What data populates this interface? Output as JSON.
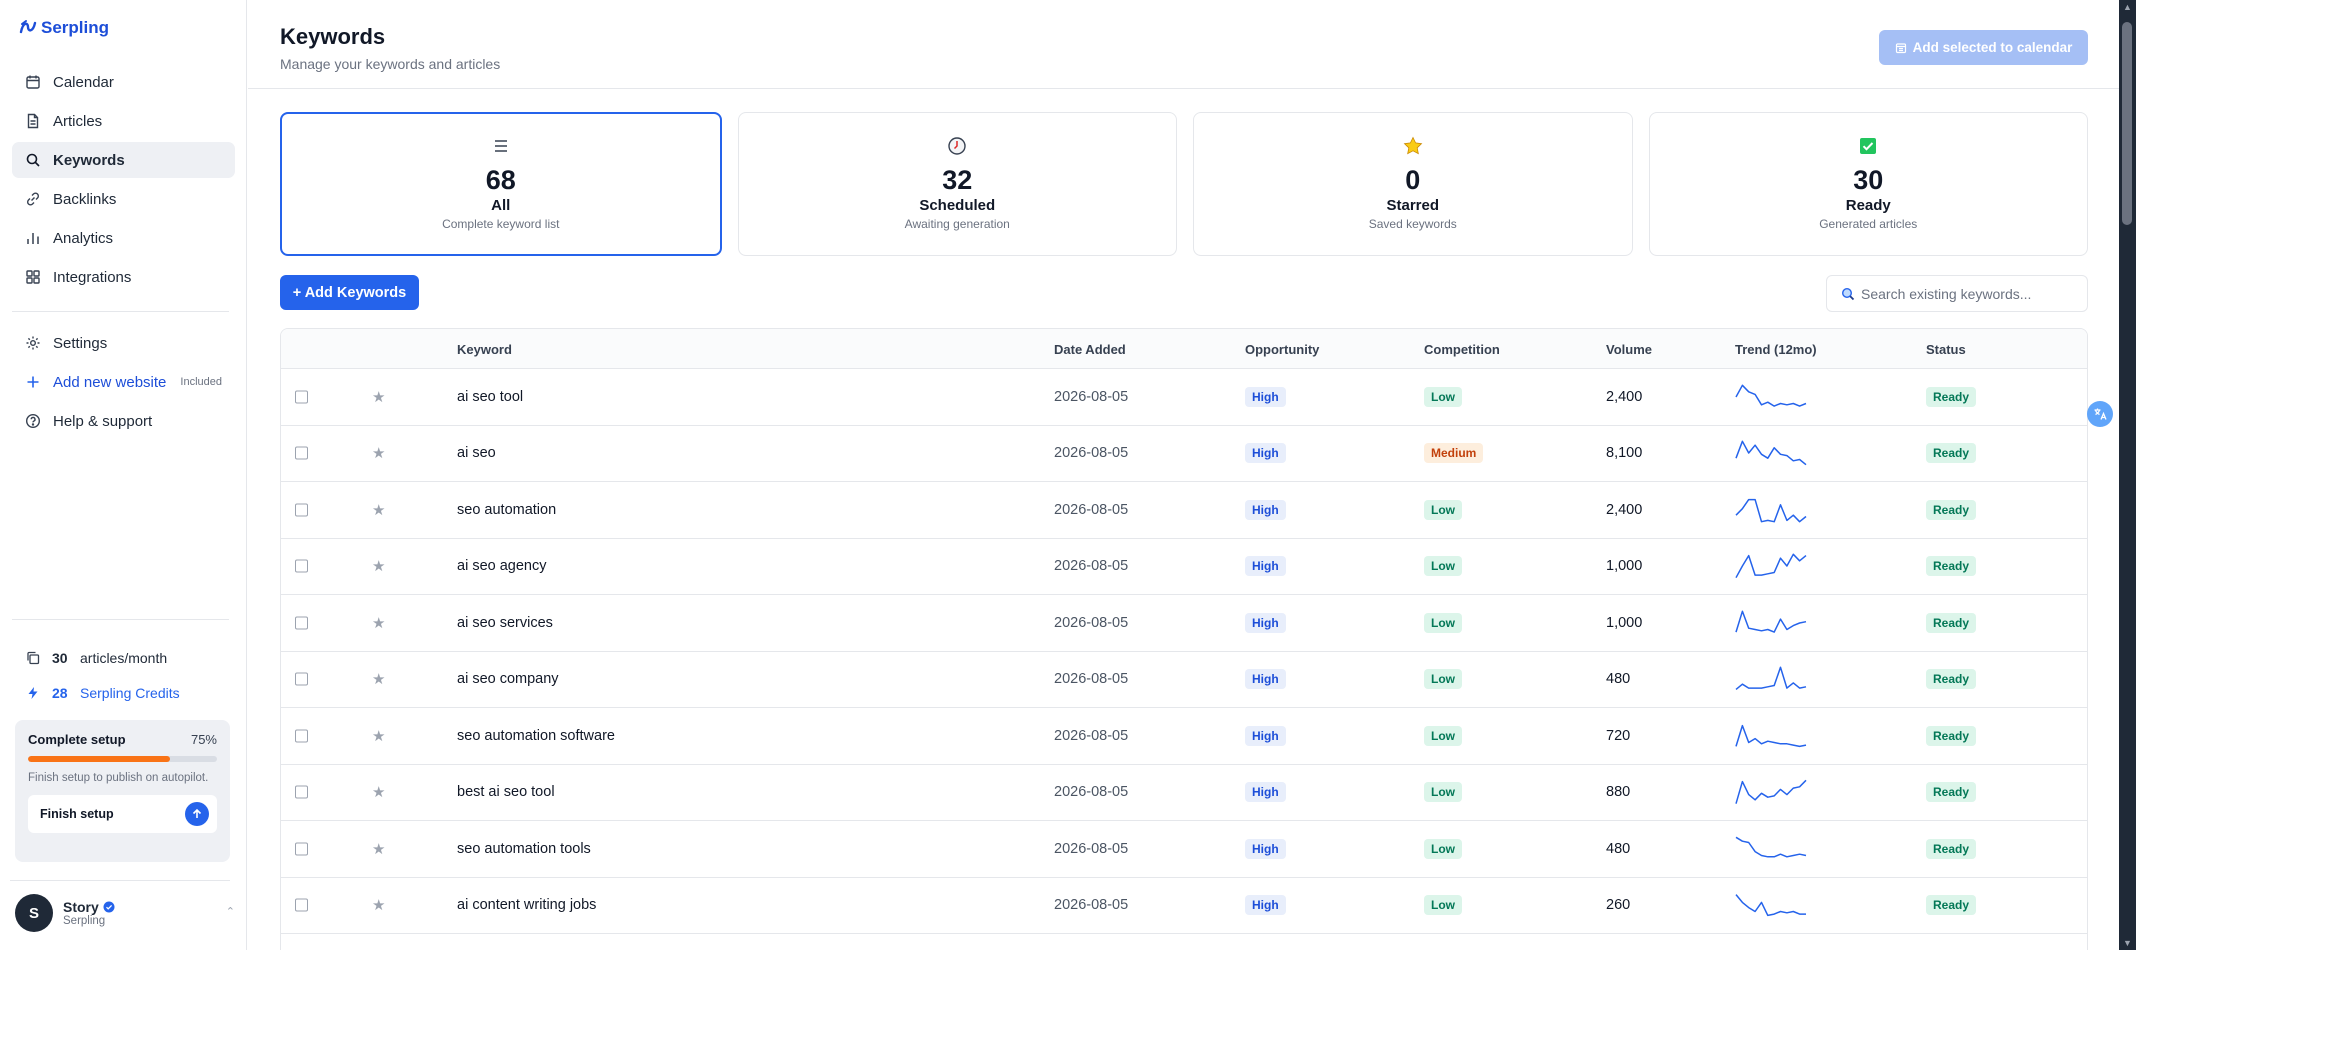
{
  "app": {
    "name": "Serpling"
  },
  "sidebar": {
    "nav": [
      {
        "label": "Calendar",
        "icon": "calendar-icon"
      },
      {
        "label": "Articles",
        "icon": "document-icon"
      },
      {
        "label": "Keywords",
        "icon": "search-icon",
        "active": true
      },
      {
        "label": "Backlinks",
        "icon": "link-icon"
      },
      {
        "label": "Analytics",
        "icon": "bar-chart-icon"
      },
      {
        "label": "Integrations",
        "icon": "grid-icon"
      }
    ],
    "settings_label": "Settings",
    "add_website_label": "Add new website",
    "add_website_badge": "Included",
    "help_label": "Help & support",
    "articles_count": "30",
    "articles_unit": "articles/month",
    "credits_count": "28",
    "credits_unit": "Serpling Credits",
    "setup": {
      "title": "Complete setup",
      "percent_label": "75%",
      "progress": 0.75,
      "description": "Finish setup to publish on autopilot.",
      "button_label": "Finish setup"
    },
    "user": {
      "initial": "S",
      "name": "Story",
      "subtitle": "Serpling"
    }
  },
  "header": {
    "title": "Keywords",
    "subtitle": "Manage your keywords and articles",
    "add_calendar_label": "Add selected to calendar"
  },
  "cards": [
    {
      "value": "68",
      "label": "All",
      "desc": "Complete keyword list",
      "icon": "list-icon"
    },
    {
      "value": "32",
      "label": "Scheduled",
      "desc": "Awaiting generation",
      "icon": "clock-icon"
    },
    {
      "value": "0",
      "label": "Starred",
      "desc": "Saved keywords",
      "icon": "star-icon"
    },
    {
      "value": "30",
      "label": "Ready",
      "desc": "Generated articles",
      "icon": "check-icon"
    }
  ],
  "toolbar": {
    "add_keywords_label": "+ Add Keywords",
    "search_placeholder": "Search existing keywords..."
  },
  "table": {
    "columns": [
      "Keyword",
      "Date Added",
      "Opportunity",
      "Competition",
      "Volume",
      "Trend (12mo)",
      "Status"
    ],
    "rows": [
      {
        "keyword": "ai seo tool",
        "date": "2026-08-05",
        "opportunity": "High",
        "competition": "Low",
        "volume": "2,400",
        "status": "Ready",
        "trend": [
          0.5,
          0.05,
          0.3,
          0.4,
          0.8,
          0.7,
          0.85,
          0.75,
          0.8,
          0.75,
          0.85,
          0.75
        ]
      },
      {
        "keyword": "ai seo",
        "date": "2026-08-05",
        "opportunity": "High",
        "competition": "Medium",
        "volume": "8,100",
        "status": "Ready",
        "trend": [
          0.7,
          0.05,
          0.5,
          0.2,
          0.55,
          0.7,
          0.3,
          0.55,
          0.6,
          0.8,
          0.75,
          0.95
        ]
      },
      {
        "keyword": "seo automation",
        "date": "2026-08-05",
        "opportunity": "High",
        "competition": "Low",
        "volume": "2,400",
        "status": "Ready",
        "trend": [
          0.7,
          0.45,
          0.1,
          0.1,
          0.95,
          0.9,
          0.95,
          0.3,
          0.9,
          0.7,
          0.95,
          0.75
        ]
      },
      {
        "keyword": "ai seo agency",
        "date": "2026-08-05",
        "opportunity": "High",
        "competition": "Low",
        "volume": "1,000",
        "status": "Ready",
        "trend": [
          0.95,
          0.5,
          0.1,
          0.85,
          0.85,
          0.8,
          0.75,
          0.2,
          0.5,
          0.05,
          0.3,
          0.1
        ]
      },
      {
        "keyword": "ai seo services",
        "date": "2026-08-05",
        "opportunity": "High",
        "competition": "Low",
        "volume": "1,000",
        "status": "Ready",
        "trend": [
          0.85,
          0.05,
          0.7,
          0.75,
          0.8,
          0.75,
          0.85,
          0.35,
          0.75,
          0.6,
          0.5,
          0.45
        ]
      },
      {
        "keyword": "ai seo company",
        "date": "2026-08-05",
        "opportunity": "High",
        "competition": "Low",
        "volume": "480",
        "status": "Ready",
        "trend": [
          0.9,
          0.7,
          0.85,
          0.85,
          0.85,
          0.8,
          0.75,
          0.05,
          0.85,
          0.65,
          0.85,
          0.8
        ]
      },
      {
        "keyword": "seo automation software",
        "date": "2026-08-05",
        "opportunity": "High",
        "competition": "Low",
        "volume": "720",
        "status": "Ready",
        "trend": [
          0.9,
          0.1,
          0.75,
          0.6,
          0.8,
          0.7,
          0.75,
          0.8,
          0.8,
          0.85,
          0.9,
          0.85
        ]
      },
      {
        "keyword": "best ai seo tool",
        "date": "2026-08-05",
        "opportunity": "High",
        "competition": "Low",
        "volume": "880",
        "status": "Ready",
        "trend": [
          0.95,
          0.1,
          0.6,
          0.8,
          0.55,
          0.7,
          0.65,
          0.4,
          0.6,
          0.35,
          0.3,
          0.05
        ]
      },
      {
        "keyword": "seo automation tools",
        "date": "2026-08-05",
        "opportunity": "High",
        "competition": "Low",
        "volume": "480",
        "status": "Ready",
        "trend": [
          0.05,
          0.2,
          0.25,
          0.6,
          0.75,
          0.8,
          0.8,
          0.7,
          0.8,
          0.75,
          0.7,
          0.75
        ]
      },
      {
        "keyword": "ai content writing jobs",
        "date": "2026-08-05",
        "opportunity": "High",
        "competition": "Low",
        "volume": "260",
        "status": "Ready",
        "trend": [
          0.1,
          0.4,
          0.6,
          0.75,
          0.4,
          0.9,
          0.85,
          0.75,
          0.8,
          0.75,
          0.85,
          0.85
        ]
      }
    ]
  },
  "colors": {
    "brand": "#2563eb",
    "brand_dark": "#1d4ed8",
    "progress": "#f97316",
    "sparkline": "#2563eb"
  }
}
